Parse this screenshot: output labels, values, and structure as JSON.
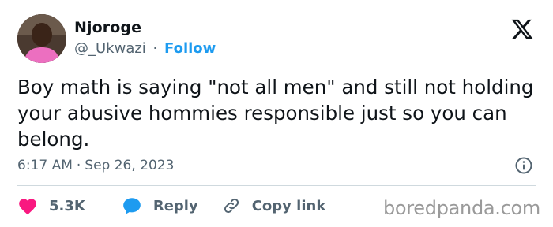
{
  "author": {
    "name": "Njoroge",
    "handle": "@_Ukwazi",
    "separator": "·",
    "follow_label": "Follow",
    "avatar_icon": "profile-photo-icon"
  },
  "brand": {
    "icon": "x-logo-icon"
  },
  "tweet": {
    "text": "Boy math is saying \"not all men\" and still not holding your abusive hommies responsible just so you can belong."
  },
  "meta": {
    "time": "6:17 AM",
    "separator": "·",
    "date": "Sep 26, 2023",
    "info_icon": "info-icon"
  },
  "actions": {
    "likes_count": "5.3K",
    "reply_label": "Reply",
    "copy_link_label": "Copy link"
  },
  "watermark": "boredpanda.com",
  "colors": {
    "text": "#0f1419",
    "secondary": "#536471",
    "accent": "#1d9bf0",
    "like": "#f91880",
    "divider": "#cfd9de"
  }
}
